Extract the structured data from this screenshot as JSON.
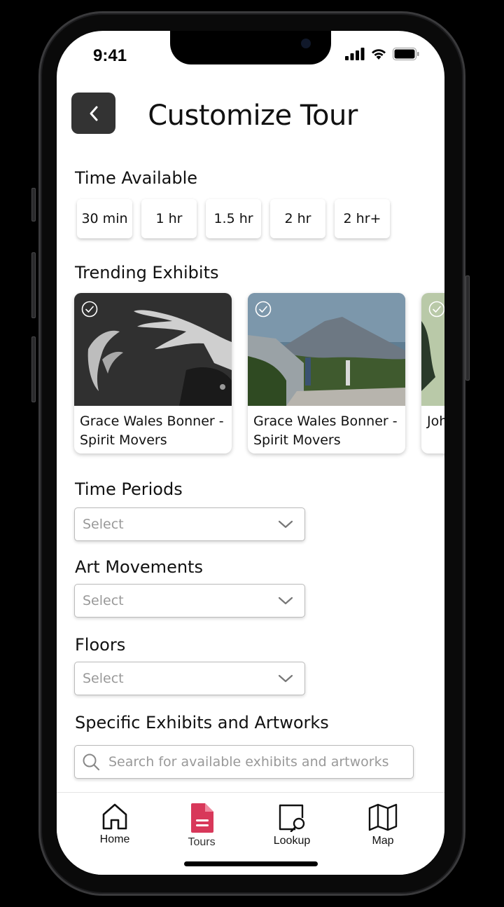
{
  "status": {
    "time": "9:41"
  },
  "header": {
    "title": "Customize Tour"
  },
  "time_available": {
    "label": "Time Available",
    "options": [
      "30 min",
      "1 hr",
      "1.5 hr",
      "2 hr",
      "2 hr+"
    ]
  },
  "trending": {
    "label": "Trending Exhibits",
    "cards": [
      {
        "title": "Grace Wales Bonner - Spirit Movers"
      },
      {
        "title": "Grace Wales Bonner - Spirit Movers"
      },
      {
        "title": "Joh Dia"
      }
    ]
  },
  "filters": {
    "time_periods": {
      "label": "Time Periods",
      "placeholder": "Select"
    },
    "art_movements": {
      "label": "Art Movements",
      "placeholder": "Select"
    },
    "floors": {
      "label": "Floors",
      "placeholder": "Select"
    }
  },
  "search": {
    "label": "Specific Exhibits and Artworks",
    "placeholder": "Search for available exhibits and artworks"
  },
  "tabs": [
    {
      "label": "Home",
      "icon": "home-icon"
    },
    {
      "label": "Tours",
      "icon": "tours-document-icon"
    },
    {
      "label": "Lookup",
      "icon": "lookup-icon"
    },
    {
      "label": "Map",
      "icon": "map-icon"
    }
  ],
  "colors": {
    "accent": "#D8385A",
    "back_button": "#333333"
  }
}
